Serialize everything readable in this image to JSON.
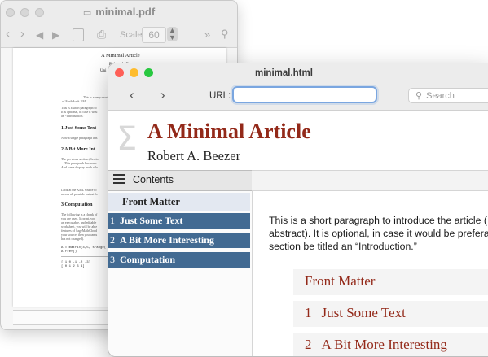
{
  "pdf_window": {
    "title": "minimal.pdf",
    "toolbar": {
      "scale_label": "Scale",
      "scale_value": "60"
    },
    "page": {
      "title": "A Minimal Article",
      "author_partial": "Robert A. Beezer",
      "affil_partial": "Uni",
      "abstract_partial": "This is a very short ar",
      "abstract_partial2": "of MathBook XML.",
      "intro_line1": "This is a short paragraph to",
      "intro_line2": "It is optional, in case it wou",
      "intro_line3": "an “Introduction.”",
      "sec1": "1  Just Some Text",
      "sec1_text": "Now a single paragraph has",
      "sec2": "2  A Bit More Int",
      "sec2_text1": "The previous section (Sectio",
      "sec2_text2": "This paragraph has some",
      "sec2_text3": "And some display math allo",
      "xml_text1": "Look at the XML source to",
      "xml_text2": "across all possible output fo",
      "sec3": "3  Computation",
      "sec3_text1": "The following is a chunk of",
      "sec3_text2": "you are used. In print, you",
      "sec3_text3": "an executable, and editable",
      "sec3_text4": "worksheet, you will be able",
      "sec3_text5": "features of SageMathCloud",
      "sec3_text6": "your source, then you can u",
      "sec3_text7": "has not changed).",
      "code1": "A = matrix(4,5, srange(",
      "code2": "A.rref()",
      "matrix1": "[ 1  0 -1 -2 -3]",
      "matrix2": "[ 0  1  2  3  4]"
    }
  },
  "web_window": {
    "title": "minimal.html",
    "url_label": "URL:",
    "url_value": "",
    "search_placeholder": "Search",
    "doc_title": "A Minimal Article",
    "doc_author": "Robert A. Beezer",
    "toc_label": "Contents",
    "toc": {
      "front_matter": "Front Matter",
      "items": [
        {
          "num": "1",
          "label": "Just Some Text"
        },
        {
          "num": "2",
          "label": "A Bit More Interesting"
        },
        {
          "num": "3",
          "label": "Computation"
        }
      ]
    },
    "intro_text": "This is a short paragraph to introduce the article (abstract). It is optional, in case it would be preferable section be titled an “Introduction.”",
    "intro_line1": "This is a short paragraph to introduce the article (",
    "intro_line2": "abstract). It is optional, in case it would be prefera",
    "intro_line3": "section be titled an “Introduction.”",
    "cards": [
      {
        "num": "",
        "label": "Front Matter"
      },
      {
        "num": "1",
        "label": "Just Some Text"
      },
      {
        "num": "2",
        "label": "A Bit More Interesting"
      }
    ],
    "colors": {
      "title_red": "#932919",
      "toc_blue": "#426a92",
      "url_focus": "#7aa6e0"
    }
  }
}
